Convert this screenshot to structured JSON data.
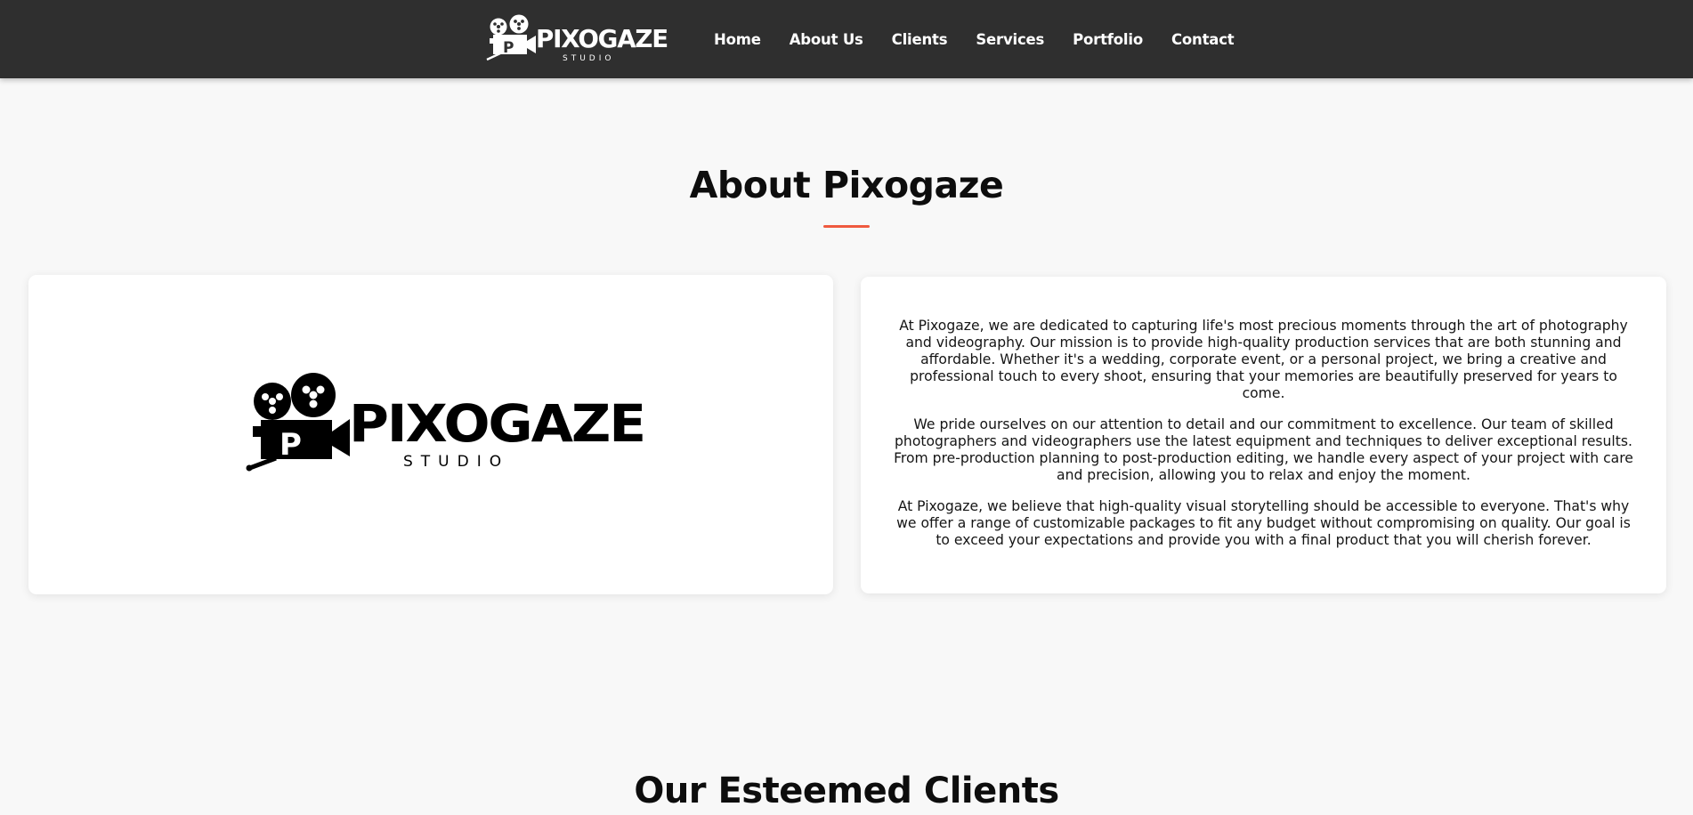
{
  "brand": {
    "name": "PIXOGAZE",
    "tagline": "STUDIO",
    "letter": "P"
  },
  "nav": {
    "items": [
      {
        "label": "Home"
      },
      {
        "label": "About Us"
      },
      {
        "label": "Clients"
      },
      {
        "label": "Services"
      },
      {
        "label": "Portfolio"
      },
      {
        "label": "Contact"
      }
    ]
  },
  "about": {
    "title": "About Pixogaze",
    "paragraphs": [
      "At Pixogaze, we are dedicated to capturing life's most precious moments through the art of photography and videography. Our mission is to provide high-quality production services that are both stunning and affordable. Whether it's a wedding, corporate event, or a personal project, we bring a creative and professional touch to every shoot, ensuring that your memories are beautifully preserved for years to come.",
      "We pride ourselves on our attention to detail and our commitment to excellence. Our team of skilled photographers and videographers use the latest equipment and techniques to deliver exceptional results. From pre-production planning to post-production editing, we handle every aspect of your project with care and precision, allowing you to relax and enjoy the moment.",
      "At Pixogaze, we believe that high-quality visual storytelling should be accessible to everyone. That's why we offer a range of customizable packages to fit any budget without compromising on quality. Our goal is to exceed your expectations and provide you with a final product that you will cherish forever."
    ]
  },
  "clients": {
    "title": "Our Esteemed Clients"
  },
  "colors": {
    "navbar": "#2f2f2f",
    "accent": "#ef5a3f",
    "background": "#f8f8f8",
    "card": "#ffffff"
  },
  "icons": {
    "brand": "film-camera-icon"
  }
}
